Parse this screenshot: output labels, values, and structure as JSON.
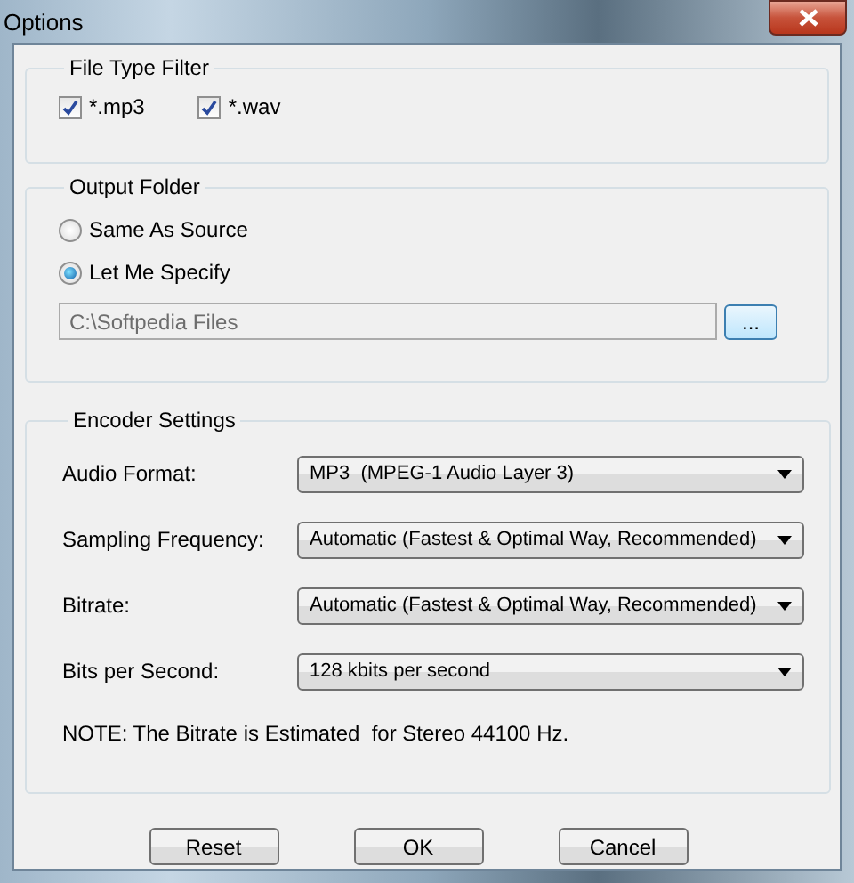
{
  "window": {
    "title": "Options"
  },
  "file_type_filter": {
    "title": "File Type Filter",
    "options": [
      {
        "label": "*.mp3",
        "checked": true
      },
      {
        "label": "*.wav",
        "checked": true
      }
    ]
  },
  "output_folder": {
    "title": "Output Folder",
    "options": [
      {
        "label": "Same As Source",
        "selected": false
      },
      {
        "label": "Let Me Specify",
        "selected": true
      }
    ],
    "path": {
      "value": "C:\\Softpedia Files",
      "disabled": true
    },
    "browse_button": "..."
  },
  "encoder_settings": {
    "title": "Encoder Settings",
    "fields": [
      {
        "label": "Audio Format:",
        "value": "MP3  (MPEG-1 Audio Layer 3)"
      },
      {
        "label": "Sampling Frequency:",
        "value": "Automatic (Fastest & Optimal Way, Recommended)"
      },
      {
        "label": "Bitrate:",
        "value": "Automatic (Fastest & Optimal Way, Recommended)"
      },
      {
        "label": "Bits per Second:",
        "value": "128 kbits per second"
      }
    ],
    "note": "NOTE: The Bitrate is Estimated  for Stereo 44100 Hz."
  },
  "buttons": [
    "Reset",
    "OK",
    "Cancel"
  ]
}
